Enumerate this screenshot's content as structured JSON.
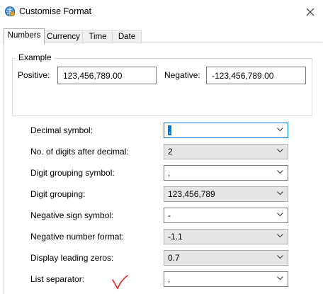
{
  "window": {
    "title": "Customise Format",
    "icon": "globe-settings-icon",
    "close_icon": "close-icon"
  },
  "tabs": [
    {
      "label": "Numbers",
      "active": true
    },
    {
      "label": "Currency",
      "active": false
    },
    {
      "label": "Time",
      "active": false
    },
    {
      "label": "Date",
      "active": false
    }
  ],
  "example": {
    "legend": "Example",
    "positive_label": "Positive:",
    "positive_value": "123,456,789.00",
    "negative_label": "Negative:",
    "negative_value": "-123,456,789.00"
  },
  "settings": [
    {
      "label": "Decimal symbol:",
      "value": ".",
      "enabled": true,
      "focused": true
    },
    {
      "label": "No. of digits after decimal:",
      "value": "2",
      "enabled": false
    },
    {
      "label": "Digit grouping symbol:",
      "value": ",",
      "enabled": true
    },
    {
      "label": "Digit grouping:",
      "value": "123,456,789",
      "enabled": false
    },
    {
      "label": "Negative sign symbol:",
      "value": "-",
      "enabled": true
    },
    {
      "label": "Negative number format:",
      "value": "-1.1",
      "enabled": false
    },
    {
      "label": "Display leading zeros:",
      "value": "0.7",
      "enabled": false
    },
    {
      "label": "List separator:",
      "value": ",",
      "enabled": true
    }
  ],
  "annotation": {
    "icon": "red-checkmark-icon",
    "color": "#e02020"
  },
  "colors": {
    "focus_highlight": "#0078d7",
    "disabled_bg": "#e6e6e6"
  }
}
